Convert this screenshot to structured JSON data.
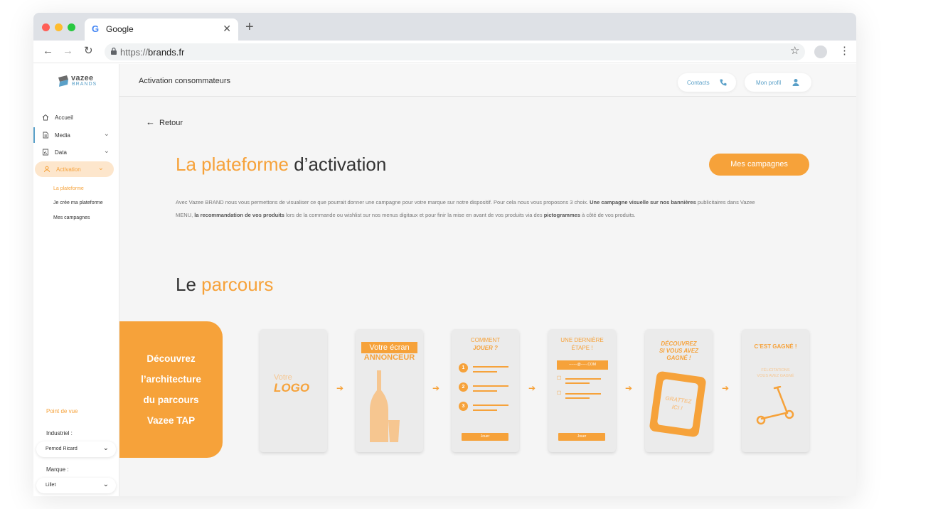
{
  "browser": {
    "tab_title": "Google",
    "tab_favicon": "G",
    "url_scheme": "https://",
    "url_host": "brands.fr"
  },
  "sidebar": {
    "logo_line1": "vazee",
    "logo_line2": "BRANDS",
    "items": [
      {
        "label": "Accueil",
        "icon": "home-icon"
      },
      {
        "label": "Media",
        "icon": "document-icon"
      },
      {
        "label": "Data",
        "icon": "data-icon"
      },
      {
        "label": "Activation",
        "icon": "user-icon"
      }
    ],
    "sub_items": [
      {
        "label": "La plateforme"
      },
      {
        "label": "Je crée ma plateforme"
      },
      {
        "label": "Mes campagnes"
      }
    ],
    "point_de_vue": "Point de vue",
    "industriel_label": "Industriel :",
    "industriel_value": "Pernod Ricard",
    "marque_label": "Marque :",
    "marque_value": "Lillet"
  },
  "header": {
    "title": "Activation consommateurs",
    "contacts": "Contacts",
    "profil": "Mon profil"
  },
  "main": {
    "back": "Retour",
    "title_orange": "La plateforme",
    "title_rest": " d’activation",
    "cta": "Mes campagnes",
    "desc_1": "Avec Vazee BRAND nous vous permettons de visualiser ce que pourrait donner une campagne pour votre marque sur notre dispositif. Pour cela nous vous proposons 3 choix. ",
    "desc_2": "Une campagne visuelle sur nos bannières",
    "desc_3": " publicitaires dans Vazee MENU, ",
    "desc_4": "la recommandation de vos produits",
    "desc_5": " lors de la commande ou wishlist sur nos menus digitaux et pour finir la mise en avant de vos produits via des ",
    "desc_6": "pictogrammes",
    "desc_7": " à côté de vos produits.",
    "section_black": "Le ",
    "section_orange": "parcours"
  },
  "promo": {
    "line1": "Découvrez",
    "line2": "l’architecture",
    "line3": "du parcours",
    "line4": "Vazee TAP"
  },
  "cards": {
    "c1_a": "Votre",
    "c1_b": "LOGO",
    "c2_band": "Votre écran",
    "c2_sub": "ANNONCEUR",
    "c3_t1": "COMMENT",
    "c3_t2": "JOUER ?",
    "c3_n1": "1",
    "c3_n2": "2",
    "c3_n3": "3",
    "c3_btn": "Jouer",
    "c4_t1": "UNE DERNIÈRE",
    "c4_t2": "ÉTAPE !",
    "c4_field": "-------@-----.COM",
    "c4_btn": "Jouer",
    "c5_t1": "DÉCOUVREZ",
    "c5_t2": "SI VOUS AVEZ",
    "c5_t3": "GAGNÉ !",
    "c5_s1": "GRATTEZ",
    "c5_s2": "ICI !",
    "c6_t": "C’EST GAGNÉ !",
    "c6_s1": "FÉLICITATIONS",
    "c6_s2": "VOUS AVEZ GAGNÉ"
  },
  "colors": {
    "accent": "#f6a23a",
    "accent_light": "#f6c690",
    "link_blue": "#5aa0c8"
  }
}
